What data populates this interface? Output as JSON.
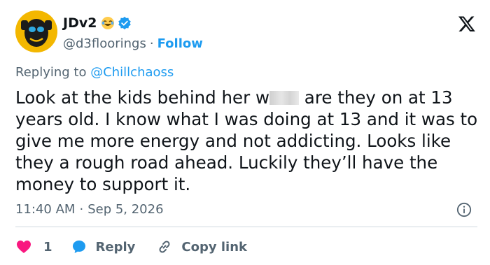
{
  "author": {
    "display_name": "JDv2",
    "handle": "@d3floorings",
    "separator": "·",
    "follow_label": "Follow",
    "emoji_icon": "laughing-face-icon",
    "verified_icon": "verified-badge-icon",
    "verified_color": "#1d9bf0"
  },
  "brand": {
    "logo_icon": "x-logo-icon",
    "color": "#0f1419"
  },
  "reply_context": {
    "prefix": "Replying to ",
    "mention": "@Chillchaoss"
  },
  "tweet": {
    "text_before_censor": "Look at the kids behind her w",
    "text_after_censor": " are they on at 13 years old. I know what I was doing at 13 and it was to give me more energy and not addicting. Looks like they a rough road ahead. Luckily they’ll have the money to support it."
  },
  "meta": {
    "time": "11:40 AM",
    "separator": "·",
    "date": "Sep 5, 2026",
    "info_icon": "info-icon"
  },
  "actions": {
    "like_count": "1",
    "like_icon": "heart-icon",
    "reply_label": "Reply",
    "reply_icon": "speech-bubble-icon",
    "copy_label": "Copy link",
    "copy_icon": "link-icon"
  },
  "colors": {
    "accent": "#1d9bf0",
    "like": "#f91880",
    "text_primary": "#0f1419",
    "text_secondary": "#536471",
    "divider": "#cfd9de"
  }
}
